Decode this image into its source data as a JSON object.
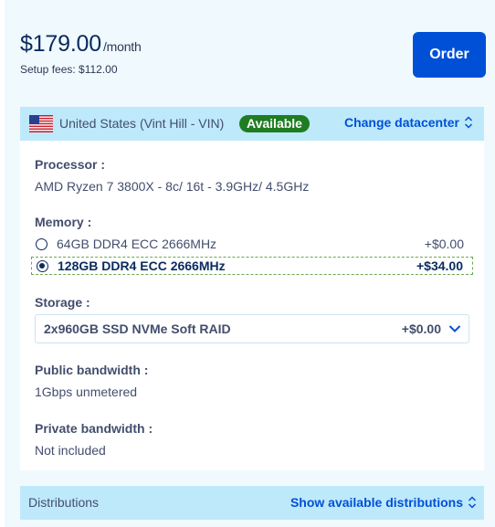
{
  "offer": {
    "price": "$179.00",
    "period": "/month",
    "setup_fees": "Setup fees: $112.00",
    "order_label": "Order"
  },
  "datacenter": {
    "flag_icon": "us-flag-icon",
    "name": "United States (Vint Hill - VIN)",
    "status": "Available",
    "status_color": "#1e7d21",
    "change_label": "Change datacenter"
  },
  "config": {
    "processor": {
      "label": "Processor :",
      "value": "AMD Ryzen 7 3800X - 8c/ 16t - 3.9GHz/ 4.5GHz"
    },
    "memory": {
      "label": "Memory :",
      "options": [
        {
          "label": "64GB DDR4 ECC 2666MHz",
          "price": "+$0.00",
          "selected": false
        },
        {
          "label": "128GB DDR4 ECC 2666MHz",
          "price": "+$34.00",
          "selected": true
        }
      ]
    },
    "storage": {
      "label": "Storage :",
      "selected": "2x960GB SSD NVMe Soft RAID",
      "price": "+$0.00"
    },
    "public_bandwidth": {
      "label": "Public bandwidth :",
      "value": "1Gbps unmetered"
    },
    "private_bandwidth": {
      "label": "Private bandwidth :",
      "value": "Not included"
    }
  },
  "distributions": {
    "label": "Distributions",
    "link": "Show available distributions"
  },
  "colors": {
    "accent": "#0050d7",
    "panel_bar": "#bde9fb",
    "card_bg": "#f0fafe"
  }
}
